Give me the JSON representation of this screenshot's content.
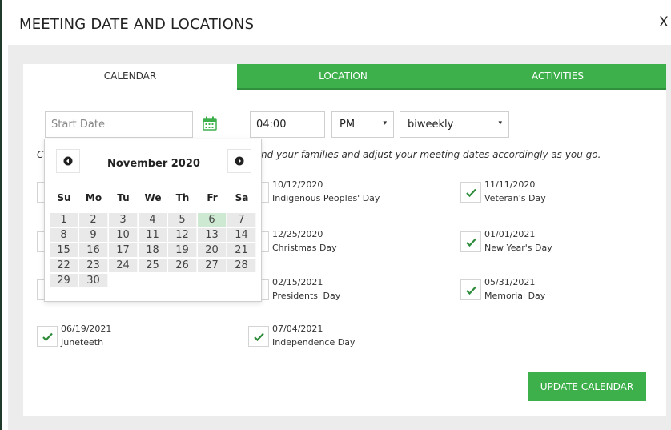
{
  "dialog": {
    "title": "MEETING DATE AND LOCATIONS",
    "close_label": "X"
  },
  "tabs": [
    {
      "label": "CALENDAR",
      "active": true
    },
    {
      "label": "LOCATION",
      "active": false
    },
    {
      "label": "ACTIVITIES",
      "active": false
    }
  ],
  "form": {
    "start_date_placeholder": "Start Date",
    "time_value": "04:00",
    "ampm_value": "PM",
    "frequency_value": "biweekly"
  },
  "instructions": {
    "lead": "C",
    "text": "nd your families and adjust your meeting dates accordingly as you go."
  },
  "holidays": [
    {
      "date": "10/12/2020",
      "name": "Indigenous Peoples' Day",
      "checked": false
    },
    {
      "date": "11/11/2020",
      "name": "Veteran's Day",
      "checked": true
    },
    {
      "date": "12/25/2020",
      "name": "Christmas Day",
      "checked": false
    },
    {
      "date": "01/01/2021",
      "name": "New Year's Day",
      "checked": true
    },
    {
      "date": "02/15/2021",
      "name": "Presidents' Day",
      "checked": false
    },
    {
      "date": "05/31/2021",
      "name": "Memorial Day",
      "checked": true
    },
    {
      "date": "06/19/2021",
      "name": "Juneteeth",
      "checked": true
    },
    {
      "date": "07/04/2021",
      "name": "Independence Day",
      "checked": true
    }
  ],
  "update_button": "UPDATE CALENDAR",
  "datepicker": {
    "month_label": "November 2020",
    "weekdays": [
      "Su",
      "Mo",
      "Tu",
      "We",
      "Th",
      "Fr",
      "Sa"
    ],
    "days": [
      "1",
      "2",
      "3",
      "4",
      "5",
      "6",
      "7",
      "8",
      "9",
      "10",
      "11",
      "12",
      "13",
      "14",
      "15",
      "16",
      "17",
      "18",
      "19",
      "20",
      "21",
      "22",
      "23",
      "24",
      "25",
      "26",
      "27",
      "28",
      "29",
      "30"
    ],
    "highlighted_day": "6"
  },
  "colors": {
    "accent": "#3eb04b",
    "check": "#2e8b3a",
    "highlight": "#cde9d2"
  }
}
